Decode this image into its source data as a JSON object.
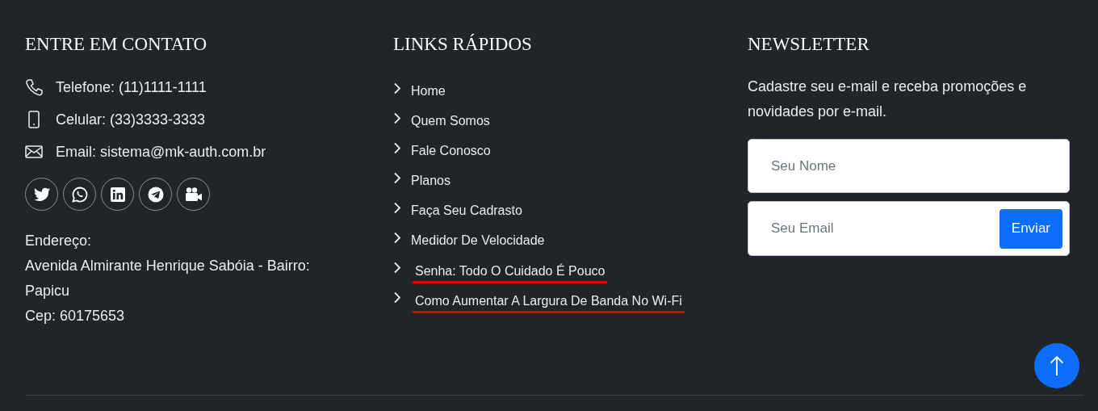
{
  "contact": {
    "title": "ENTRE EM CONTATO",
    "items": [
      {
        "kind": "phone",
        "text": "Telefone: (11)1111-1111"
      },
      {
        "kind": "mobile",
        "text": "Celular: (33)3333-3333"
      },
      {
        "kind": "email",
        "text": "Email: sistema@mk-auth.com.br"
      }
    ],
    "social": [
      {
        "kind": "twitter"
      },
      {
        "kind": "whatsapp"
      },
      {
        "kind": "linkedin"
      },
      {
        "kind": "telegram"
      },
      {
        "kind": "video"
      }
    ],
    "address": [
      "Endereço:",
      "Avenida Almirante Henrique Sabóia - Bairro: Papicu",
      "Cep: 60175653"
    ]
  },
  "links": {
    "title": "LINKS RÁPIDOS",
    "items": [
      {
        "text": "Home",
        "underlined": false
      },
      {
        "text": "Quem Somos",
        "underlined": false
      },
      {
        "text": "Fale Conosco",
        "underlined": false
      },
      {
        "text": "Planos",
        "underlined": false
      },
      {
        "text": "Faça Seu Cadrasto",
        "underlined": false
      },
      {
        "text": "Medidor De Velocidade",
        "underlined": false
      },
      {
        "text": "Senha: Todo O Cuidado É Pouco",
        "underlined": true
      },
      {
        "text": "Como Aumentar A Largura De Banda No Wi-Fi",
        "underlined": true
      }
    ]
  },
  "newsletter": {
    "title": "NEWSLETTER",
    "text": "Cadastre seu e-mail e receba promoções e novidades por e-mail.",
    "name_field": {
      "placeholder": "Seu Nome"
    },
    "email_field": {
      "placeholder": "Seu Email"
    },
    "button": "Enviar"
  },
  "back_to_top": {
    "kind": "arrow-up"
  }
}
